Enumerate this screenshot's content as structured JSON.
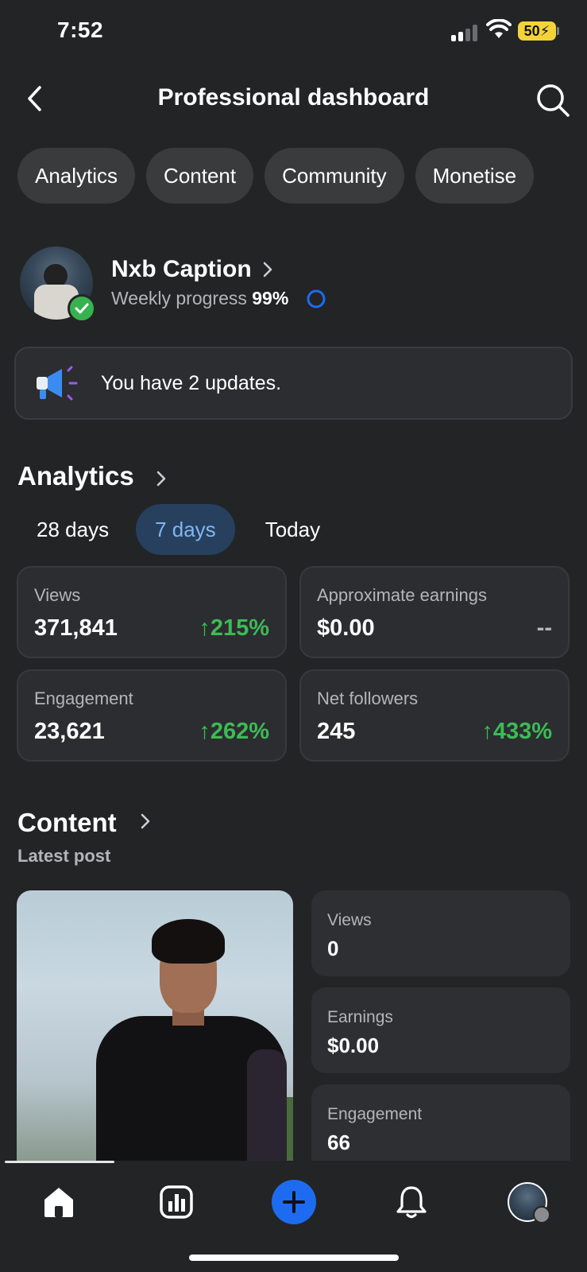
{
  "status_bar": {
    "time": "7:52",
    "battery": "50"
  },
  "header": {
    "title": "Professional dashboard"
  },
  "tabs": [
    {
      "label": "Analytics"
    },
    {
      "label": "Content"
    },
    {
      "label": "Community"
    },
    {
      "label": "Monetise"
    }
  ],
  "profile": {
    "name": "Nxb Caption",
    "weekly_label": "Weekly progress",
    "weekly_value": "99%"
  },
  "updates": {
    "text": "You have 2 updates."
  },
  "analytics": {
    "title": "Analytics",
    "periods": [
      {
        "label": "28 days",
        "active": false
      },
      {
        "label": "7 days",
        "active": true
      },
      {
        "label": "Today",
        "active": false
      }
    ],
    "cards": [
      {
        "label": "Views",
        "value": "371,841",
        "change": "↑215%"
      },
      {
        "label": "Approximate earnings",
        "value": "$0.00",
        "change": "--"
      },
      {
        "label": "Engagement",
        "value": "23,621",
        "change": "↑262%"
      },
      {
        "label": "Net followers",
        "value": "245",
        "change": "↑433%"
      }
    ]
  },
  "content": {
    "title": "Content",
    "subtitle": "Latest post",
    "stats": [
      {
        "label": "Views",
        "value": "0"
      },
      {
        "label": "Earnings",
        "value": "$0.00"
      },
      {
        "label": "Engagement",
        "value": "66"
      }
    ]
  },
  "bottom_nav": [
    "home-icon",
    "insights-icon",
    "create-icon",
    "notifications-icon",
    "profile-avatar"
  ],
  "colors": {
    "accent": "#1d6bf0",
    "positive": "#3dbb56",
    "active_tab_bg": "#26405e",
    "active_tab_text": "#7fb6f4"
  }
}
